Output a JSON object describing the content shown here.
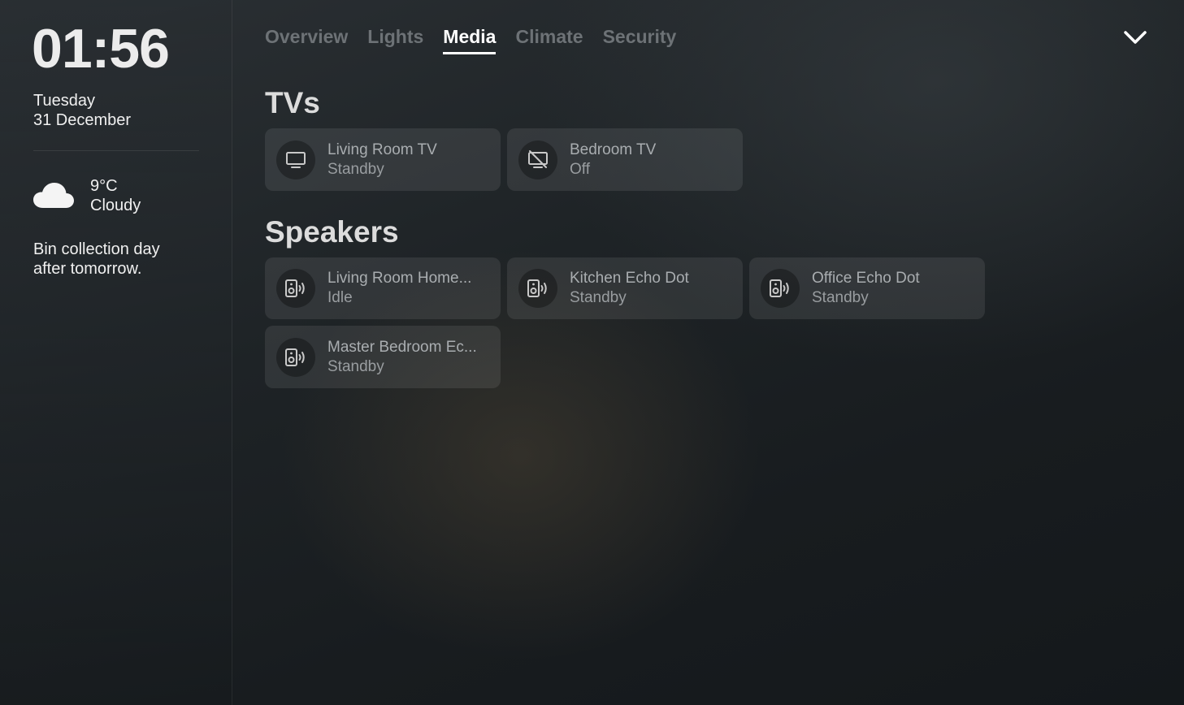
{
  "sidebar": {
    "time": "01:56",
    "day": "Tuesday",
    "date": "31 December",
    "weather": {
      "temperature": "9°C",
      "condition": "Cloudy",
      "icon": "cloud-icon"
    },
    "notice": "Bin collection day after tomorrow."
  },
  "tabs": [
    {
      "label": "Overview",
      "active": false
    },
    {
      "label": "Lights",
      "active": false
    },
    {
      "label": "Media",
      "active": true
    },
    {
      "label": "Climate",
      "active": false
    },
    {
      "label": "Security",
      "active": false
    }
  ],
  "collapse_icon": "chevron-down-icon",
  "sections": {
    "tvs": {
      "title": "TVs",
      "devices": [
        {
          "name": "Living Room TV",
          "state": "Standby",
          "icon": "tv-icon"
        },
        {
          "name": "Bedroom TV",
          "state": "Off",
          "icon": "tv-off-icon"
        }
      ]
    },
    "speakers": {
      "title": "Speakers",
      "devices": [
        {
          "name": "Living Room Home...",
          "state": "Idle",
          "icon": "speaker-icon"
        },
        {
          "name": "Kitchen Echo Dot",
          "state": "Standby",
          "icon": "speaker-icon"
        },
        {
          "name": "Office Echo Dot",
          "state": "Standby",
          "icon": "speaker-icon"
        },
        {
          "name": "Master Bedroom Ec...",
          "state": "Standby",
          "icon": "speaker-icon"
        }
      ]
    }
  }
}
